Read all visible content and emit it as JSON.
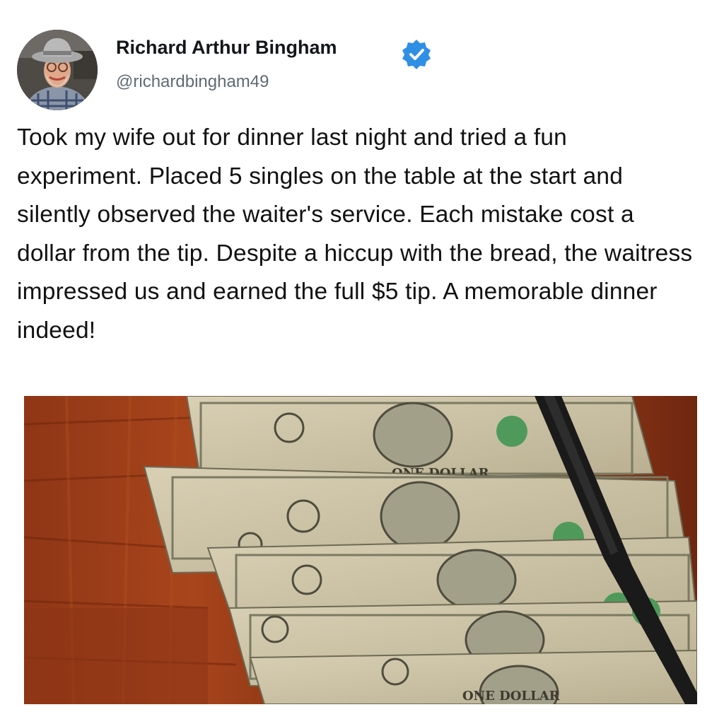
{
  "tweet": {
    "author_name": "Richard Arthur Bingham",
    "handle": "@richardbingham49",
    "verified": true,
    "text": "Took my wife out for dinner last night and tried a fun experiment. Placed 5 singles on the table at the start and silently observed the waiter's service. Each mistake cost a dollar from the tip. Despite a hiccup with the bread, the waitress impressed us and earned the full $5 tip. A memorable dinner indeed!"
  },
  "icons": {
    "verified_badge": "verified-check-icon",
    "verified_color": "#1d9bf0"
  },
  "photo": {
    "subject": "five one-dollar bills fanned on a wooden table with a knife"
  }
}
